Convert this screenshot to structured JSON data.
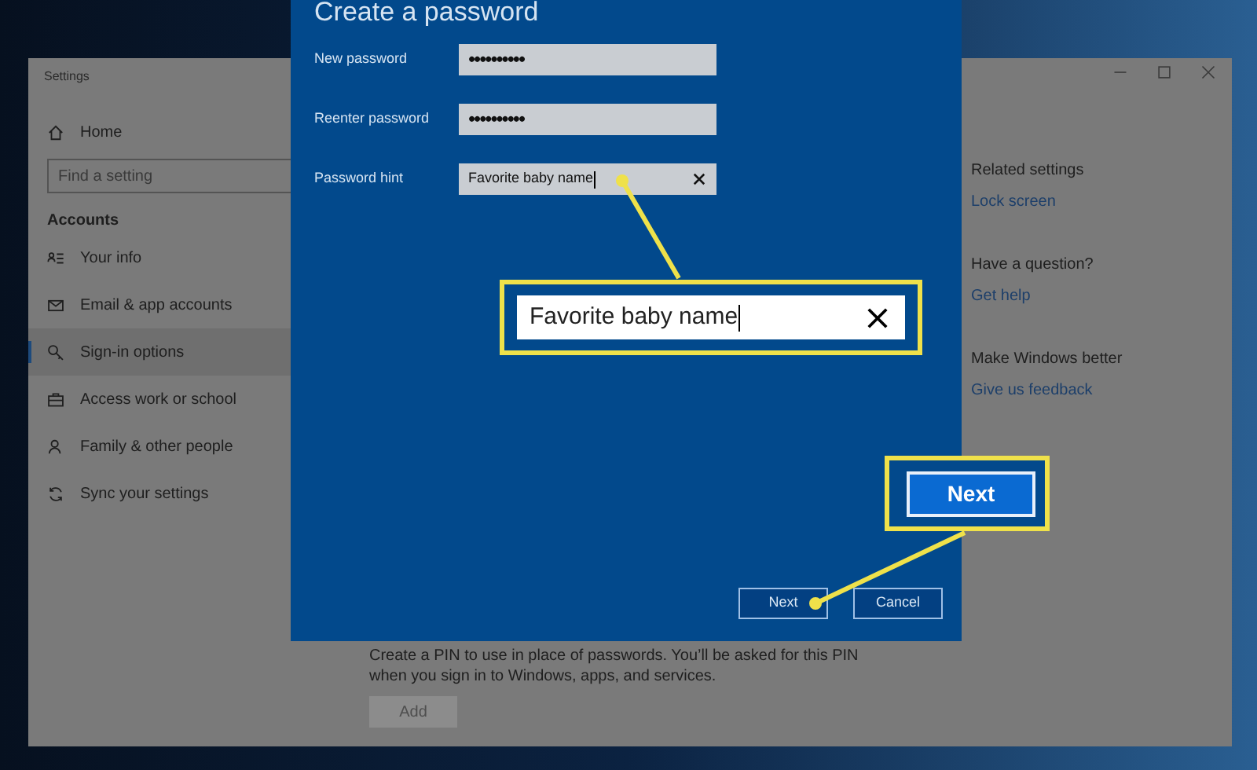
{
  "settings_window": {
    "title": "Settings",
    "sidebar": {
      "home": "Home",
      "search": {
        "placeholder": "Find a setting"
      },
      "section": "Accounts",
      "items": [
        {
          "label": "Your info",
          "selected": false
        },
        {
          "label": "Email & app accounts",
          "selected": false
        },
        {
          "label": "Sign-in options",
          "selected": true
        },
        {
          "label": "Access work or school",
          "selected": false
        },
        {
          "label": "Family & other people",
          "selected": false
        },
        {
          "label": "Sync your settings",
          "selected": false
        }
      ]
    },
    "pin_section": {
      "description": "Create a PIN to use in place of passwords. You’ll be asked for this PIN when you sign in to Windows, apps, and services.",
      "add_button": {
        "label": "Add",
        "disabled": true
      }
    },
    "related": [
      {
        "heading": "Related settings",
        "link": "Lock screen"
      },
      {
        "heading": "Have a question?",
        "link": "Get help"
      },
      {
        "heading": "Make Windows better",
        "link": "Give us feedback"
      }
    ]
  },
  "dialog": {
    "title": "Create a password",
    "fields": [
      {
        "label": "New password",
        "value": "••••••••••",
        "kind": "password"
      },
      {
        "label": "Reenter password",
        "value": "••••••••••",
        "kind": "password"
      },
      {
        "label": "Password hint",
        "value": "Favorite baby name",
        "kind": "text"
      }
    ],
    "buttons": [
      {
        "label": "Next"
      },
      {
        "label": "Cancel"
      }
    ]
  },
  "callouts": [
    {
      "kind": "field",
      "value": "Favorite baby name"
    },
    {
      "kind": "button",
      "label": "Next"
    }
  ]
}
